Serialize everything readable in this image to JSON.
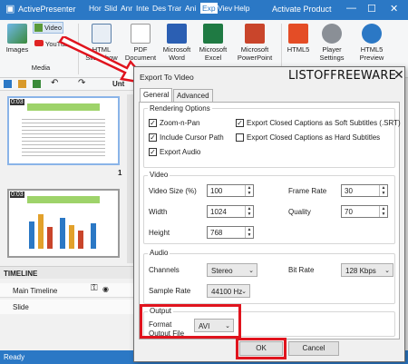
{
  "app": {
    "title": "ActivePresenter",
    "activate": "Activate Product",
    "tabs": [
      "Hor",
      "Slid",
      "Anr",
      "Inte",
      "Des",
      "Trar",
      "Ani",
      "Exp",
      "Viev",
      "Help"
    ],
    "active_tab": "Exp"
  },
  "ribbon": {
    "images": "Images",
    "video": "Video",
    "youtube": "YouTube",
    "media_group": "Media",
    "html_slideshow": "HTML SlideShow",
    "pdf": "PDF Document",
    "word": "Microsoft Word",
    "excel": "Microsoft Excel",
    "powerpoint": "Microsoft PowerPoint",
    "html5": "HTML5",
    "player_settings": "Player Settings",
    "html5_preview": "HTML5 Preview"
  },
  "left": {
    "slide1_time": "0:03",
    "slide1_num": "1",
    "slide2_time": "0:03",
    "doc_tab": "Unt",
    "timeline": "TIMELINE",
    "main_timeline": "Main Timeline",
    "slide": "Slide"
  },
  "status": {
    "text": "Ready"
  },
  "dialog": {
    "title": "Export To Video",
    "brand": "LISTOFFREEWARE",
    "close": "✕",
    "tab_general": "General",
    "tab_advanced": "Advanced",
    "rendering": {
      "title": "Rendering Options",
      "zoom_pan": "Zoom-n-Pan",
      "cursor_path": "Include Cursor Path",
      "export_audio": "Export Audio",
      "cc_soft": "Export Closed Captions as Soft Subtitles (.SRT)",
      "cc_hard": "Export Closed Captions as Hard Subtitles"
    },
    "video": {
      "title": "Video",
      "size_label": "Video Size (%)",
      "size": "100",
      "width_label": "Width",
      "width": "1024",
      "height_label": "Height",
      "height": "768",
      "framerate_label": "Frame Rate",
      "framerate": "30",
      "quality_label": "Quality",
      "quality": "70"
    },
    "audio": {
      "title": "Audio",
      "channels_label": "Channels",
      "channels": "Stereo",
      "bitrate_label": "Bit Rate",
      "bitrate": "128 Kbps",
      "samplerate_label": "Sample Rate",
      "samplerate": "44100 Hz"
    },
    "output": {
      "title": "Output",
      "format_label": "Format",
      "file_label": "Output File",
      "format": "AVI"
    },
    "ok": "OK",
    "cancel": "Cancel"
  },
  "colors": {
    "accent": "#2b78c5",
    "highlight": "#e0141e"
  }
}
